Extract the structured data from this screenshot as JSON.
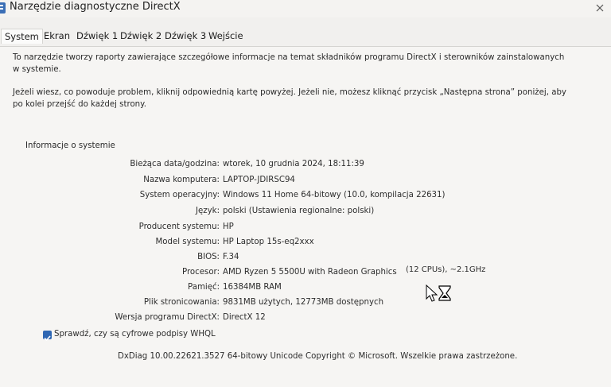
{
  "window": {
    "title": "Narzędzie diagnostyczne DirectX"
  },
  "tabs": [
    {
      "label": "System"
    },
    {
      "label": "Ekran"
    },
    {
      "label": "Dźwięk 1"
    },
    {
      "label": "Dźwięk 2"
    },
    {
      "label": "Dźwięk 3"
    },
    {
      "label": "Wejście"
    }
  ],
  "intro": {
    "line1": "To narzędzie tworzy raporty zawierające szczegółowe informacje na temat składników programu DirectX i sterowników zainstalowanych",
    "line2": "w systemie.",
    "line3": "Jeżeli wiesz, co powoduje problem, kliknij odpowiednią kartę powyżej. Jeżeli nie, możesz kliknąć przycisk „Następna strona” poniżej, aby",
    "line4": "po kolei przejść do każdej strony."
  },
  "section_label": "Informacje o systemie",
  "rows": [
    {
      "label": "Bieżąca data/godzina:",
      "value": "wtorek, 10 grudnia 2024, 18:11:39"
    },
    {
      "label": "Nazwa komputera:",
      "value": "LAPTOP-JDIRSC94"
    },
    {
      "label": "System operacyjny:",
      "value": "Windows 11 Home 64-bitowy (10.0, kompilacja 22631)"
    },
    {
      "label": "Język:",
      "value": "polski (Ustawienia regionalne: polski)"
    },
    {
      "label": "Producent systemu:",
      "value": "HP"
    },
    {
      "label": "Model systemu:",
      "value": "HP Laptop 15s-eq2xxx"
    },
    {
      "label": "BIOS:",
      "value": "F.34"
    },
    {
      "label": "Procesor:",
      "value": "AMD Ryzen 5 5500U with Radeon Graphics"
    },
    {
      "label": "Pamięć:",
      "value": "16384MB RAM"
    },
    {
      "label": "Plik stronicowania:",
      "value": "9831MB użytych, 12773MB dostępnych"
    },
    {
      "label": "Wersja programu DirectX:",
      "value": "DirectX 12"
    }
  ],
  "processor_extra": "(12 CPUs), ~2.1GHz",
  "checkbox": {
    "label": "Sprawdź, czy są cyfrowe podpisy WHQL",
    "checked": true
  },
  "footer": "DxDiag 10.00.22621.3527 64-bitowy Unicode  Copyright © Microsoft. Wszelkie prawa zastrzeżone.",
  "icons": {
    "app": "dx-app-icon",
    "close": "close-icon",
    "cursor": "busy-cursor-icon"
  },
  "colors": {
    "checkbox": "#2f67b3",
    "background": "#f6f5f3"
  }
}
